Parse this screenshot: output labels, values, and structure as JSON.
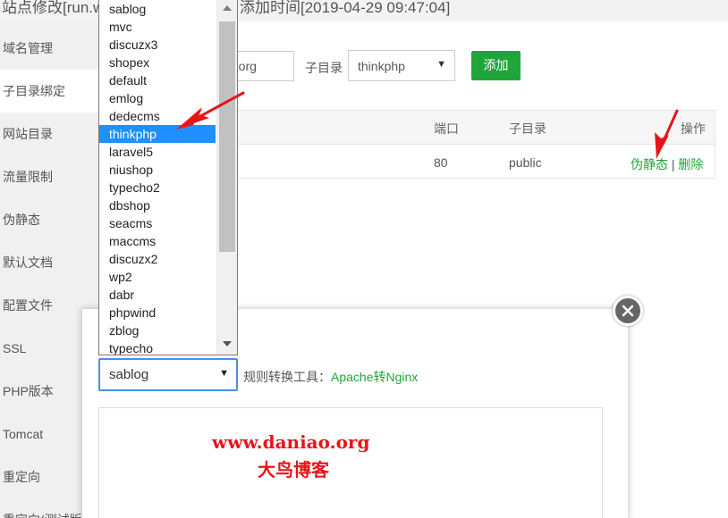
{
  "window": {
    "title_left": "站点修改[run.w",
    "title_right": "添加时间[2019-04-29 09:47:04]"
  },
  "sidebar": {
    "items": [
      {
        "label": "域名管理"
      },
      {
        "label": "子目录绑定"
      },
      {
        "label": "网站目录"
      },
      {
        "label": "流量限制"
      },
      {
        "label": "伪静态"
      },
      {
        "label": "默认文档"
      },
      {
        "label": "配置文件"
      },
      {
        "label": "SSL"
      },
      {
        "label": "PHP版本"
      },
      {
        "label": "Tomcat"
      },
      {
        "label": "重定向"
      },
      {
        "label": "重定向(测试版)"
      }
    ]
  },
  "form": {
    "domain_value": "g.org",
    "subdir_label": "子目录",
    "subdir_value": "thinkphp",
    "add_label": "添加"
  },
  "table": {
    "headers": {
      "port": "端口",
      "subdir": "子目录",
      "action": "操作"
    },
    "rows": [
      {
        "frag": ")",
        "port": "80",
        "subdir": "public",
        "rewrite": "伪静态",
        "separator": "|",
        "delete": "删除"
      }
    ]
  },
  "dropdown": {
    "options": [
      "sablog",
      "mvc",
      "discuzx3",
      "shopex",
      "default",
      "emlog",
      "dedecms",
      "thinkphp",
      "laravel5",
      "niushop",
      "typecho2",
      "dbshop",
      "seacms",
      "maccms",
      "discuzx2",
      "wp2",
      "dabr",
      "phpwind",
      "zblog",
      "typecho"
    ],
    "selected_index": 7
  },
  "modal": {
    "select_value": "sablog",
    "rule_tool_label": "规则转换工具：",
    "rule_tool_link": "Apache转Nginx"
  },
  "watermark": {
    "line1": "www.daniao.org",
    "line2": "大鸟博客"
  },
  "colors": {
    "accent": "#20a53a",
    "selected": "#1e90ff",
    "annotation": "#e8141a"
  },
  "icons": {
    "close": "close-icon",
    "dropdown": "chevron-down-icon"
  }
}
